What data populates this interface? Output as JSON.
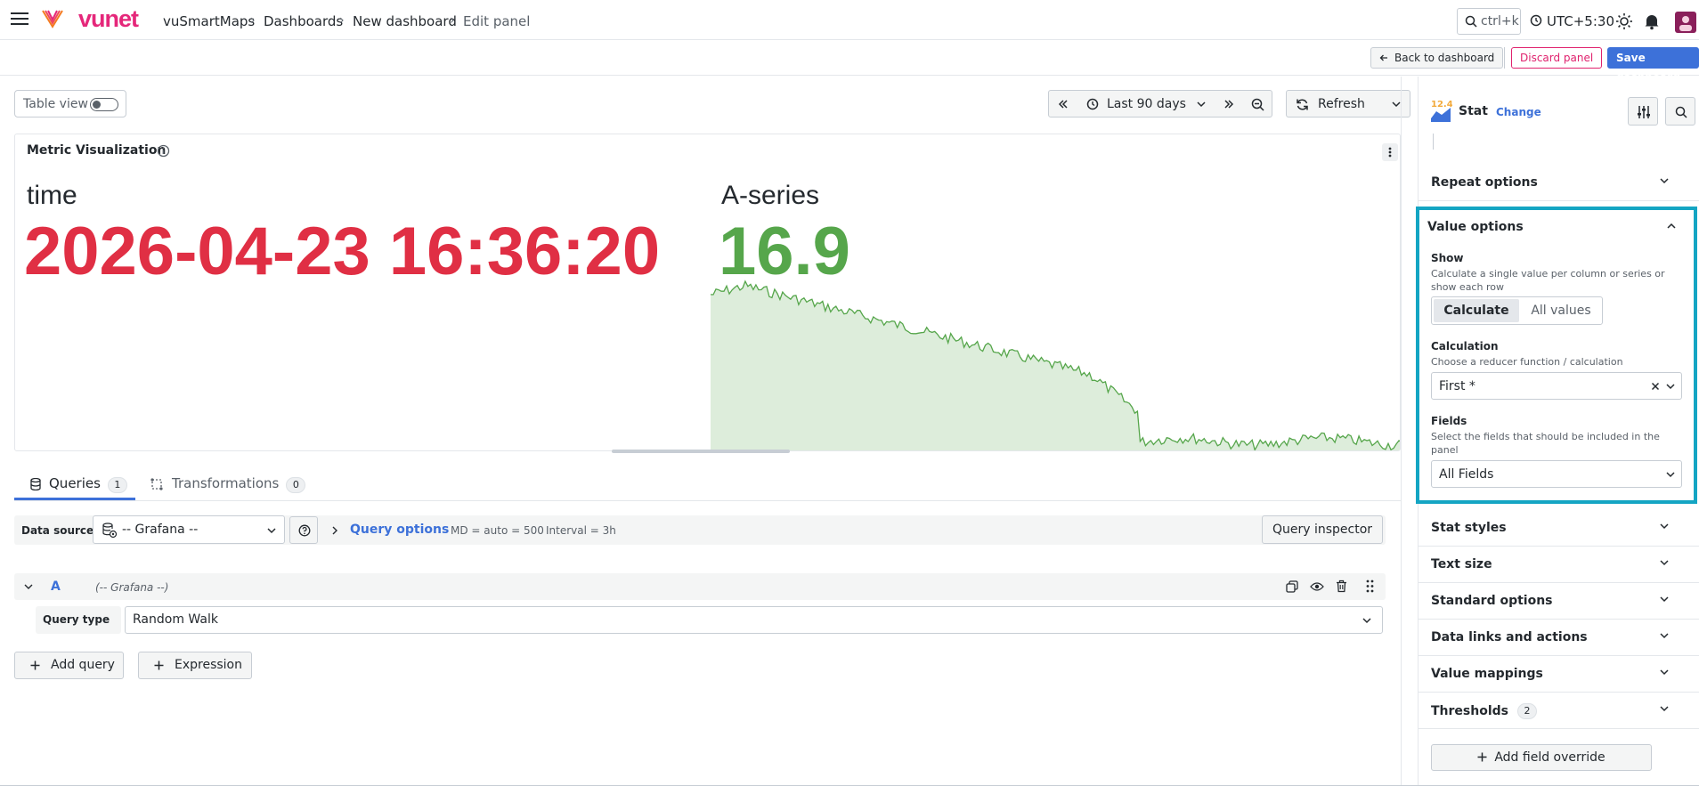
{
  "header": {
    "logo_text": "vunet",
    "breadcrumbs": [
      "vuSmartMaps",
      "Dashboards",
      "New dashboard",
      "Edit panel"
    ],
    "search_shortcut": "ctrl+k",
    "timezone": "UTC+5:30"
  },
  "toolbar": {
    "back_label": "Back to dashboard",
    "discard_label": "Discard panel",
    "save_label": "Save dashboard"
  },
  "controls": {
    "table_view_label": "Table view",
    "time_range": "Last 90 days",
    "refresh_label": "Refresh"
  },
  "panel": {
    "title": "Metric Visualization",
    "stats": [
      {
        "label": "time",
        "value": "2026-04-23 16:36:20",
        "color": "#e02f44"
      },
      {
        "label": "A-series",
        "value": "16.9",
        "color": "#56a64b"
      }
    ]
  },
  "tabs": {
    "queries_label": "Queries",
    "queries_count": "1",
    "transformations_label": "Transformations",
    "transformations_count": "0"
  },
  "query": {
    "datasource_label": "Data source",
    "datasource_value": "-- Grafana --",
    "options_label": "Query options",
    "md_text": "MD = auto = 500",
    "interval_text": "Interval = 3h",
    "inspector_label": "Query inspector",
    "row_letter": "A",
    "row_datasource": "(-- Grafana --)",
    "query_type_label": "Query type",
    "query_type_value": "Random Walk",
    "add_query_label": "Add query",
    "expression_label": "Expression"
  },
  "sidebar": {
    "viz_version": "12.4",
    "viz_name": "Stat",
    "change_label": "Change",
    "repeat_options": "Repeat options",
    "value_options": {
      "title": "Value options",
      "show_label": "Show",
      "show_desc": "Calculate a single value per column or series or show each row",
      "show_options": [
        "Calculate",
        "All values"
      ],
      "calc_label": "Calculation",
      "calc_desc": "Choose a reducer function / calculation",
      "calc_value": "First *",
      "fields_label": "Fields",
      "fields_desc": "Select the fields that should be included in the panel",
      "fields_value": "All Fields"
    },
    "sections": [
      "Stat styles",
      "Text size",
      "Standard options",
      "Data links and actions",
      "Value mappings",
      "Thresholds"
    ],
    "thresholds_count": "2",
    "add_override_label": "Add field override"
  },
  "colors": {
    "accent": "#3d71d9",
    "highlight_border": "#14a5c3",
    "brand": "#e5277a",
    "stat_red": "#e02f44",
    "stat_green": "#56a64b"
  }
}
